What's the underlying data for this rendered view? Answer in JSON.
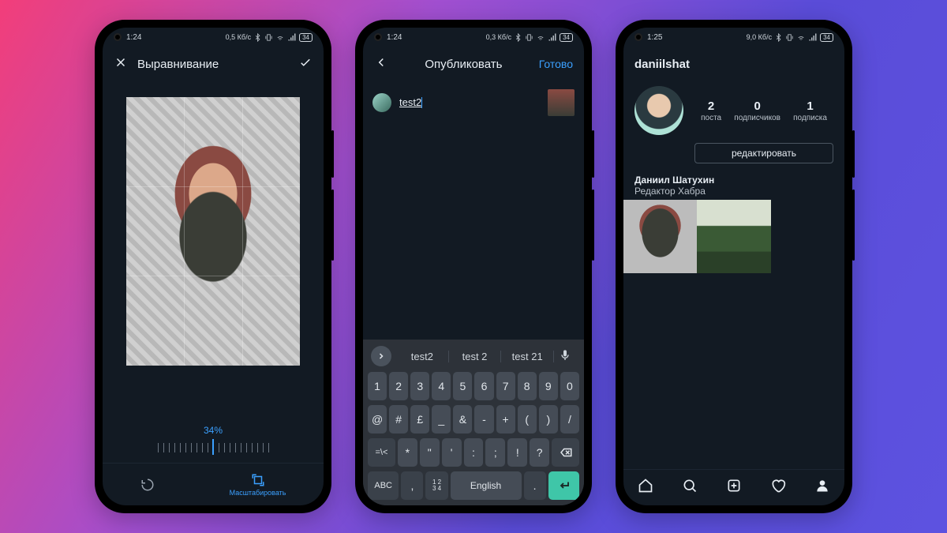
{
  "phone1": {
    "status": {
      "time": "1:24",
      "net": "0,5 Кб/с",
      "batt": "34"
    },
    "header": {
      "title": "Выравнивание"
    },
    "zoom_percent": "34%",
    "tools": {
      "rotate": "",
      "scale_label": "Масштабировать"
    }
  },
  "phone2": {
    "status": {
      "time": "1:24",
      "net": "0,3 Кб/с",
      "batt": "34"
    },
    "header": {
      "title": "Опубликовать",
      "done": "Готово"
    },
    "caption": "test2",
    "keyboard": {
      "suggestions": [
        "test2",
        "test 2",
        "test 21"
      ],
      "row1": [
        {
          "k": "1"
        },
        {
          "k": "2"
        },
        {
          "k": "3"
        },
        {
          "k": "4"
        },
        {
          "k": "5"
        },
        {
          "k": "6"
        },
        {
          "k": "7"
        },
        {
          "k": "8"
        },
        {
          "k": "9"
        },
        {
          "k": "0"
        }
      ],
      "row2": [
        {
          "k": "@"
        },
        {
          "k": "#"
        },
        {
          "k": "£"
        },
        {
          "k": "_"
        },
        {
          "k": "&"
        },
        {
          "k": "-"
        },
        {
          "k": "+"
        },
        {
          "k": "("
        },
        {
          "k": ")"
        },
        {
          "k": "/"
        }
      ],
      "row3_shift": "=\\<",
      "row3": [
        {
          "k": "*"
        },
        {
          "k": "\""
        },
        {
          "k": "'"
        },
        {
          "k": ":"
        },
        {
          "k": ";"
        },
        {
          "k": "!"
        },
        {
          "k": "?"
        }
      ],
      "row4": {
        "abc": "ABC",
        "comma": ",",
        "numtoggle": "1 2\n3 4",
        "space": "English",
        "dot": "."
      }
    }
  },
  "phone3": {
    "status": {
      "time": "1:25",
      "net": "9,0 Кб/с",
      "batt": "34"
    },
    "username": "daniilshat",
    "stats": {
      "posts_n": "2",
      "posts_l": "поста",
      "followers_n": "0",
      "followers_l": "подписчиков",
      "following_n": "1",
      "following_l": "подписка"
    },
    "edit_label": "редактировать",
    "bio": {
      "name": "Даниил Шатухин",
      "sub": "Редактор Хабра"
    }
  }
}
